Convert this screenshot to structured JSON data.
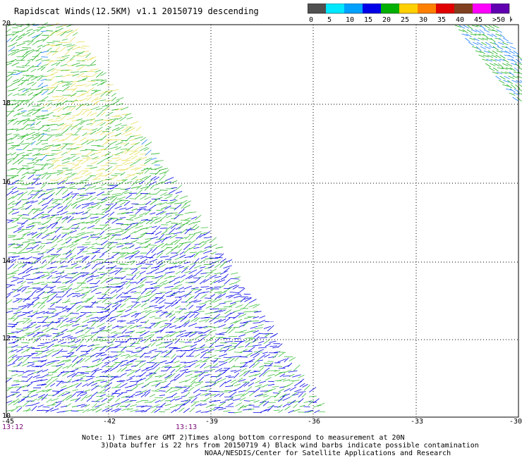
{
  "title": "Rapidscat Winds(12.5KM) v1.1 20150719 descending",
  "colorbar": {
    "labels": [
      "0",
      "5",
      "10",
      "15",
      "20",
      "25",
      "30",
      "35",
      "40",
      "45",
      ">50 knots"
    ],
    "colors": [
      "#505050",
      "#00e8ff",
      "#00a0ff",
      "#0000e8",
      "#00b000",
      "#ffd000",
      "#ff8000",
      "#e00000",
      "#804020",
      "#ff00ff",
      "#6000b0"
    ]
  },
  "map": {
    "lat_labels": [
      "20",
      "18",
      "16",
      "14",
      "12",
      "10"
    ],
    "lon_labels": [
      "-45",
      "-42",
      "-39",
      "-36",
      "-33",
      "-30"
    ],
    "time_labels": [
      "13:12",
      "13:13"
    ]
  },
  "notes": {
    "line1": "Note: 1) Times are GMT 2)Times along bottom correspond to measurement at 20N",
    "line2": "3)Data buffer is 22 hrs from 20150719 4) Black wind barbs indicate possible contamination",
    "line3": "NOAA/NESDIS/Center for Satellite Applications and Research"
  }
}
